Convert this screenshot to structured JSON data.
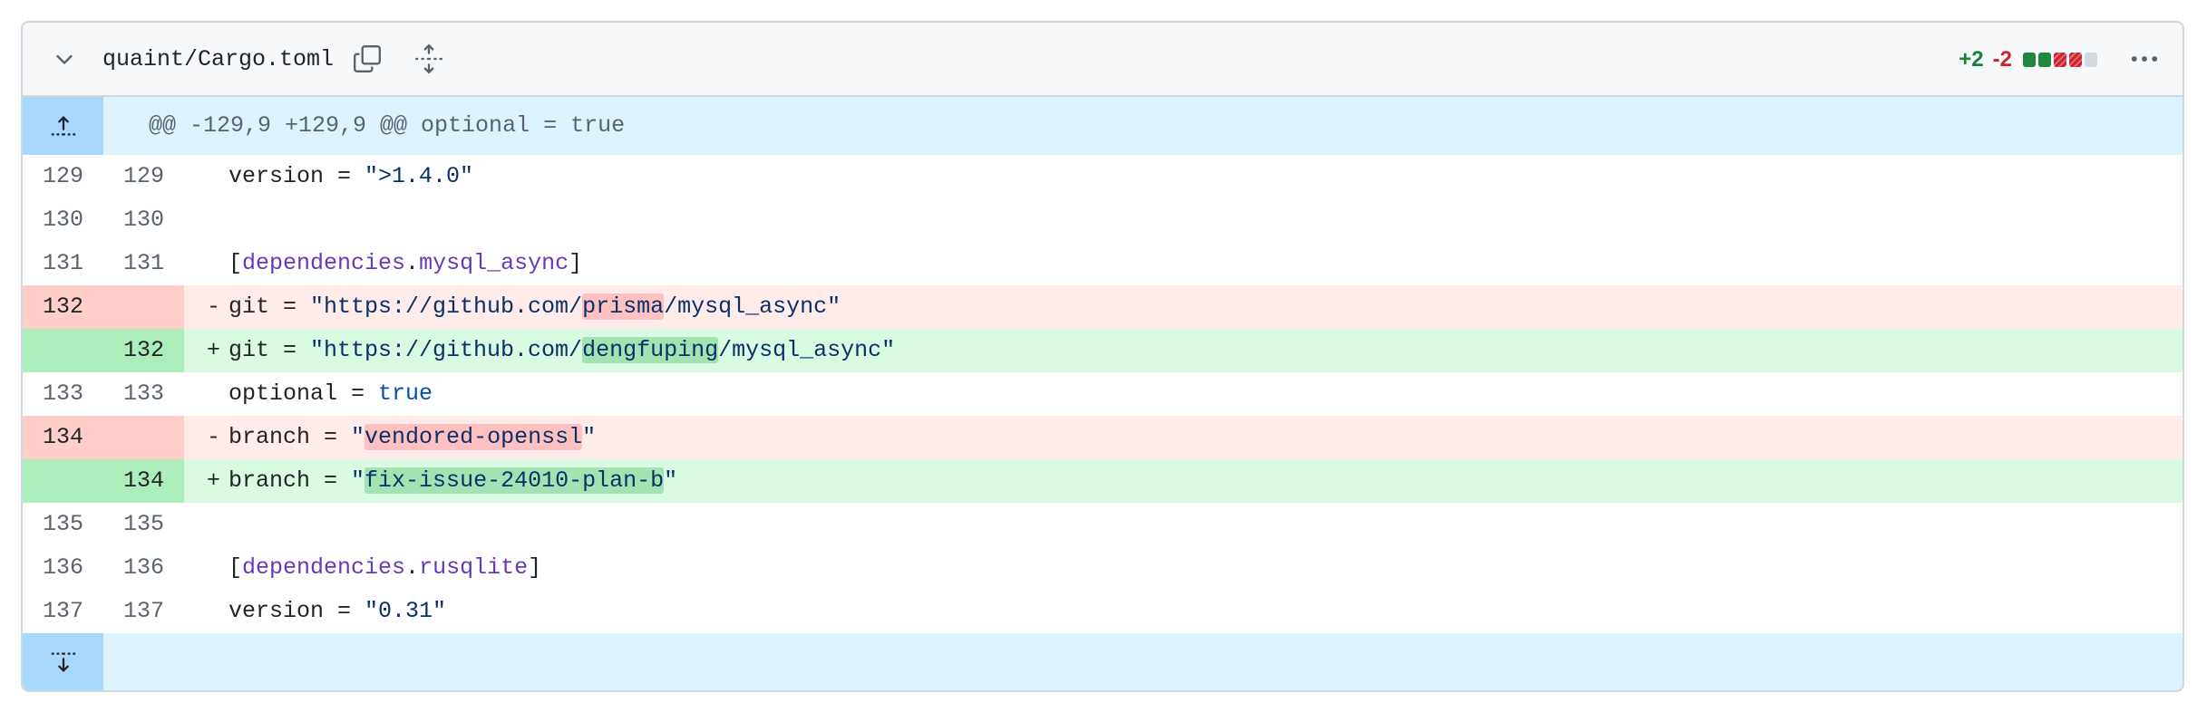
{
  "file": {
    "name": "quaint/Cargo.toml",
    "additions": "+2",
    "deletions": "-2",
    "diffstat": [
      "green",
      "green",
      "red",
      "red",
      "gray"
    ],
    "colors": {
      "green": "#1f883d",
      "red": "#cf222e",
      "gray": "#d1d9e0"
    }
  },
  "hunk": {
    "header": "@@ -129,9 +129,9 @@ optional = true"
  },
  "lines": [
    {
      "type": "ctx",
      "old": "129",
      "new": "129",
      "parts": [
        [
          "",
          "version = "
        ],
        [
          "str",
          "\">1.4.0\""
        ]
      ]
    },
    {
      "type": "ctx",
      "old": "130",
      "new": "130",
      "parts": []
    },
    {
      "type": "ctx",
      "old": "131",
      "new": "131",
      "parts": [
        [
          "",
          "["
        ],
        [
          "key",
          "dependencies"
        ],
        [
          "",
          "."
        ],
        [
          "key",
          "mysql_async"
        ],
        [
          "",
          "]"
        ]
      ]
    },
    {
      "type": "del",
      "old": "132",
      "new": "",
      "sign": "-",
      "parts": [
        [
          "",
          "git = "
        ],
        [
          "str",
          "\"https://github.com/"
        ],
        [
          "hl-del str",
          "prisma"
        ],
        [
          "str",
          "/mysql_async\""
        ]
      ]
    },
    {
      "type": "add",
      "old": "",
      "new": "132",
      "sign": "+",
      "parts": [
        [
          "",
          "git = "
        ],
        [
          "str",
          "\"https://github.com/"
        ],
        [
          "hl-add str",
          "dengfuping"
        ],
        [
          "str",
          "/mysql_async\""
        ]
      ]
    },
    {
      "type": "ctx",
      "old": "133",
      "new": "133",
      "parts": [
        [
          "",
          "optional = "
        ],
        [
          "bool",
          "true"
        ]
      ]
    },
    {
      "type": "del",
      "old": "134",
      "new": "",
      "sign": "-",
      "parts": [
        [
          "",
          "branch = "
        ],
        [
          "str",
          "\""
        ],
        [
          "hl-del str",
          "vendored-openssl"
        ],
        [
          "str",
          "\""
        ]
      ]
    },
    {
      "type": "add",
      "old": "",
      "new": "134",
      "sign": "+",
      "parts": [
        [
          "",
          "branch = "
        ],
        [
          "str",
          "\""
        ],
        [
          "hl-add str",
          "fix-issue-24010-plan-b"
        ],
        [
          "str",
          "\""
        ]
      ]
    },
    {
      "type": "ctx",
      "old": "135",
      "new": "135",
      "parts": []
    },
    {
      "type": "ctx",
      "old": "136",
      "new": "136",
      "parts": [
        [
          "",
          "["
        ],
        [
          "key",
          "dependencies"
        ],
        [
          "",
          "."
        ],
        [
          "key",
          "rusqlite"
        ],
        [
          "",
          "]"
        ]
      ]
    },
    {
      "type": "ctx",
      "old": "137",
      "new": "137",
      "parts": [
        [
          "",
          "version = "
        ],
        [
          "str",
          "\"0.31\""
        ]
      ]
    }
  ]
}
